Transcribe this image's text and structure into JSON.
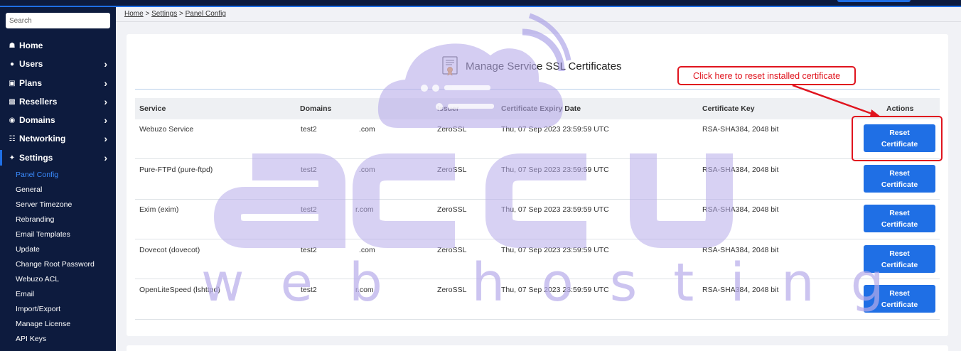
{
  "sidebar": {
    "search_placeholder": "Search",
    "nav": [
      {
        "label": "Home",
        "icon": "home-icon",
        "has_arrow": false
      },
      {
        "label": "Users",
        "icon": "user-icon",
        "has_arrow": true
      },
      {
        "label": "Plans",
        "icon": "plans-icon",
        "has_arrow": true
      },
      {
        "label": "Resellers",
        "icon": "resellers-icon",
        "has_arrow": true
      },
      {
        "label": "Domains",
        "icon": "globe-icon",
        "has_arrow": true
      },
      {
        "label": "Networking",
        "icon": "network-icon",
        "has_arrow": true
      },
      {
        "label": "Settings",
        "icon": "wrench-icon",
        "has_arrow": true
      }
    ],
    "settings_sub": [
      "Panel Config",
      "General",
      "Server Timezone",
      "Rebranding",
      "Email Templates",
      "Update",
      "Change Root Password",
      "Webuzo ACL",
      "Email",
      "Import/Export",
      "Manage License",
      "API Keys"
    ],
    "active_sub": "Panel Config"
  },
  "breadcrumb": {
    "home": "Home",
    "settings": "Settings",
    "current": "Panel Config",
    "sep": ">"
  },
  "page": {
    "title": "Manage Service SSL Certificates"
  },
  "table": {
    "headers": [
      "Service",
      "Domains",
      "Issuer",
      "Certificate Expiry Date",
      "Certificate Key",
      "Actions"
    ],
    "rows": [
      {
        "service": "Webuzo Service",
        "domain_a": "test2",
        "domain_b": ".com",
        "issuer": "ZeroSSL",
        "expiry": "Thu, 07 Sep 2023 23:59:59 UTC",
        "key": "RSA-SHA384, 2048 bit",
        "action": "Reset Certificate"
      },
      {
        "service": "Pure-FTPd (pure-ftpd)",
        "domain_a": "test2",
        "domain_b": ".com",
        "issuer": "ZeroSSL",
        "expiry": "Thu, 07 Sep 2023 23:59:59 UTC",
        "key": "RSA-SHA384, 2048 bit",
        "action": "Reset Certificate"
      },
      {
        "service": "Exim (exim)",
        "domain_a": "test2",
        "domain_b": "r.com",
        "issuer": "ZeroSSL",
        "expiry": "Thu, 07 Sep 2023 23:59:59 UTC",
        "key": "RSA-SHA384, 2048 bit",
        "action": "Reset Certificate"
      },
      {
        "service": "Dovecot (dovecot)",
        "domain_a": "test2",
        "domain_b": ".com",
        "issuer": "ZeroSSL",
        "expiry": "Thu, 07 Sep 2023 23:59:59 UTC",
        "key": "RSA-SHA384, 2048 bit",
        "action": "Reset Certificate"
      },
      {
        "service": "OpenLiteSpeed (lshttpd)",
        "domain_a": "test2",
        "domain_b": "r.com",
        "issuer": "ZeroSSL",
        "expiry": "Thu, 07 Sep 2023 23:59:59 UTC",
        "key": "RSA-SHA384, 2048 bit",
        "action": "Reset Certificate"
      }
    ]
  },
  "annotation": {
    "callout": "Click here to reset installed certificate"
  },
  "watermark": {
    "logo": "accu",
    "tagline": "web hosting"
  },
  "colors": {
    "sidebar_bg": "#0d1b3e",
    "accent": "#1f6fe5",
    "annotation": "#e0141e",
    "watermark": "#b7acea"
  }
}
